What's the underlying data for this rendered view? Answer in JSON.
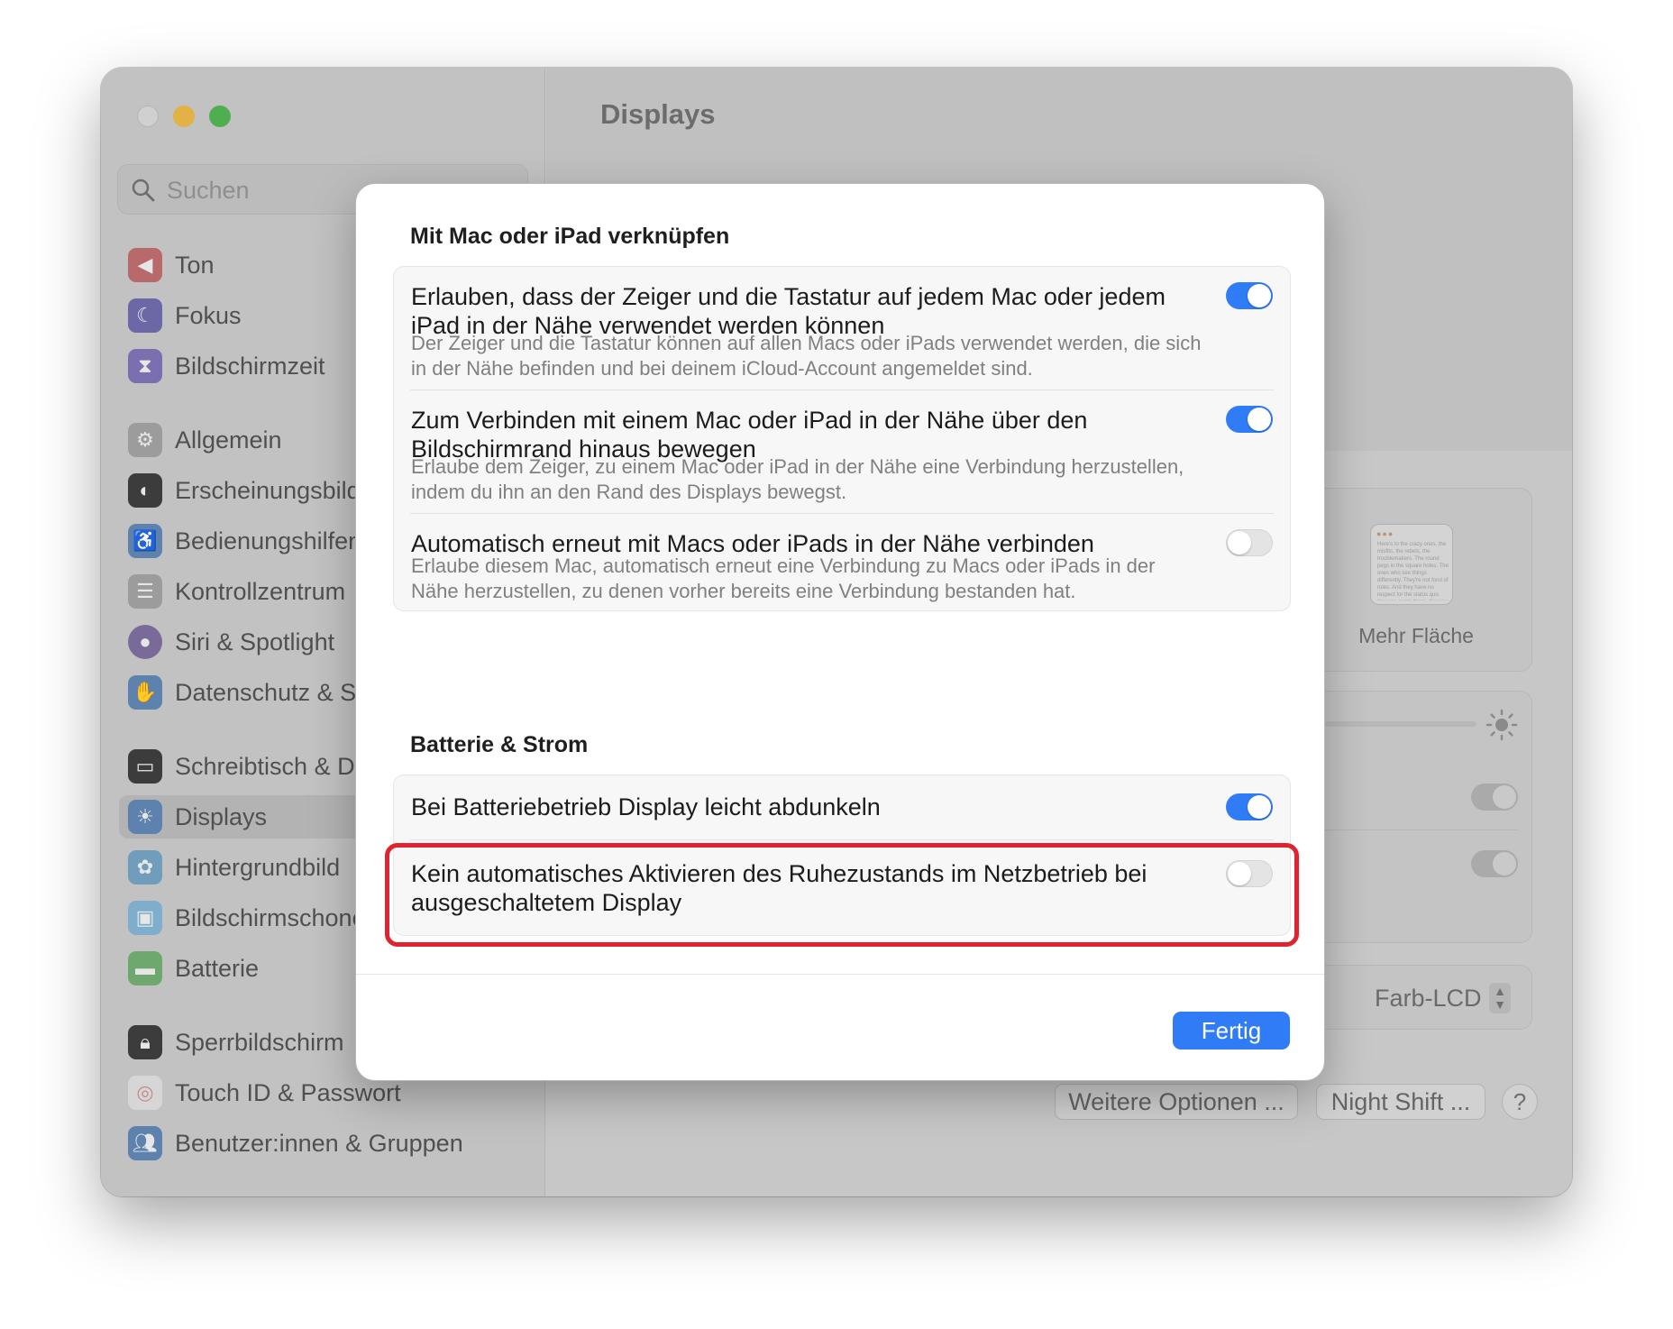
{
  "sidebar": {
    "search_placeholder": "Suchen",
    "items": [
      {
        "label": "Ton",
        "icon": "speaker-icon",
        "color": "#b86a6a"
      },
      {
        "label": "Fokus",
        "icon": "moon-icon",
        "color": "#6c68a8"
      },
      {
        "label": "Bildschirmzeit",
        "icon": "hourglass-icon",
        "color": "#7b6fb0"
      },
      {
        "label": "Allgemein",
        "icon": "gear-icon",
        "color": "#9c9c9c"
      },
      {
        "label": "Erscheinungsbild",
        "icon": "appearance-icon",
        "color": "#3c3c3c"
      },
      {
        "label": "Bedienungshilfen",
        "icon": "accessibility-icon",
        "color": "#5d82ad"
      },
      {
        "label": "Kontrollzentrum",
        "icon": "toggles-icon",
        "color": "#9c9c9c"
      },
      {
        "label": "Siri & Spotlight",
        "icon": "siri-icon",
        "color": "#7a6a9a"
      },
      {
        "label": "Datenschutz & Sicherheit",
        "icon": "hand-icon",
        "color": "#5d82ad"
      },
      {
        "label": "Schreibtisch & Dock",
        "icon": "dock-icon",
        "color": "#3c3c3c"
      },
      {
        "label": "Displays",
        "icon": "sun-icon",
        "color": "#5d82ad"
      },
      {
        "label": "Hintergrundbild",
        "icon": "flower-icon",
        "color": "#6f9dbb"
      },
      {
        "label": "Bildschirmschoner",
        "icon": "screensaver-icon",
        "color": "#7eaecb"
      },
      {
        "label": "Batterie",
        "icon": "battery-icon",
        "color": "#6fa86f"
      },
      {
        "label": "Sperrbildschirm",
        "icon": "lock-icon",
        "color": "#3c3c3c"
      },
      {
        "label": "Touch ID & Passwort",
        "icon": "fingerprint-icon",
        "color": "#c48a8a"
      },
      {
        "label": "Benutzer:innen & Gruppen",
        "icon": "users-icon",
        "color": "#5d82ad"
      }
    ]
  },
  "main": {
    "title": "Displays",
    "mehr_flaeche": "Mehr Fläche",
    "mini_window_text": "Here's to the crazy ones, the misfits, the rebels, the troublemakers. The round pegs in the square holes. The ones who see things differently. They're not fond of rules. And they have no respect for the status quo. You can quote them, disagree with them, glorify or vilify them. About the only thing you can't do is ignore them. Because they change things.",
    "color_profile": "Farb-LCD",
    "more_options_label": "Weitere Optionen ...",
    "night_shift_label": "Night Shift ...",
    "help_label": "?"
  },
  "dialog": {
    "section1_title": "Mit Mac oder iPad verknüpfen",
    "section1_rows": [
      {
        "title": "Erlauben, dass der Zeiger und die Tastatur auf jedem Mac oder jedem iPad in der Nähe verwendet werden können",
        "desc": "Der Zeiger und die Tastatur können auf allen Macs oder iPads verwendet werden, die sich in der Nähe befinden und bei deinem iCloud-Account angemeldet sind.",
        "on": true
      },
      {
        "title": "Zum Verbinden mit einem Mac oder iPad in der Nähe über den Bildschirmrand hinaus bewegen",
        "desc": "Erlaube dem Zeiger, zu einem Mac oder iPad in der Nähe eine Verbindung herzustellen, indem du ihn an den Rand des Displays bewegst.",
        "on": true
      },
      {
        "title": "Automatisch erneut mit Macs oder iPads in der Nähe verbinden",
        "desc": "Erlaube diesem Mac, automatisch erneut eine Verbindung zu Macs oder iPads in der Nähe herzustellen, zu denen vorher bereits eine Verbindung bestanden hat.",
        "on": false
      }
    ],
    "section2_title": "Batterie & Strom",
    "section2_rows": [
      {
        "title": "Bei Batteriebetrieb Display leicht abdunkeln",
        "on": true
      },
      {
        "title": "Kein automatisches Aktivieren des Ruhezustands im Netzbetrieb bei ausgeschaltetem Display",
        "on": false
      }
    ],
    "done_label": "Fertig",
    "highlight_color": "#e0232e",
    "accent_color": "#2f7cf6"
  }
}
